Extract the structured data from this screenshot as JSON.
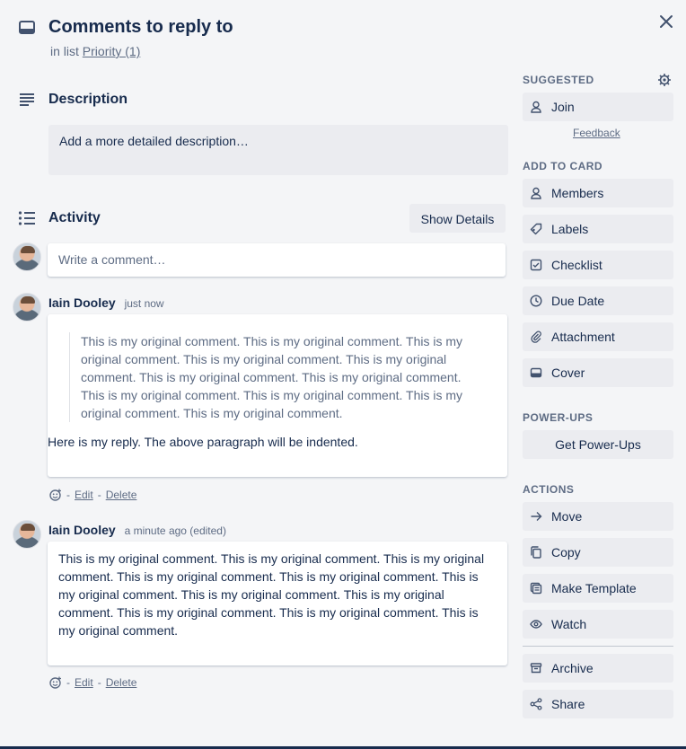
{
  "card": {
    "title": "Comments to reply to",
    "in_list_prefix": "in list",
    "list_name": "Priority (1)"
  },
  "description": {
    "heading": "Description",
    "placeholder": "Add a more detailed description…"
  },
  "activity": {
    "heading": "Activity",
    "show_details": "Show Details",
    "comment_placeholder": "Write a comment…",
    "comments": [
      {
        "author": "Iain Dooley",
        "time": "just now",
        "quote": "This is my original comment. This is my original comment. This is my original comment. This is my original comment. This is my original comment. This is my original comment. This is my original comment. This is my original comment. This is my original comment. This is my original comment. This is my original comment.",
        "body": "Here is my reply. The above paragraph will be indented.",
        "separator": "-",
        "edit": "Edit",
        "delete": "Delete"
      },
      {
        "author": "Iain Dooley",
        "time": "a minute ago (edited)",
        "body": "This is my original comment. This is my original comment. This is my original comment. This is my original comment. This is my original comment. This is my original comment. This is my original comment. This is my original comment. This is my original comment. This is my original comment. This is my original comment.",
        "separator": "-",
        "edit": "Edit",
        "delete": "Delete"
      }
    ]
  },
  "sidebar": {
    "suggested": {
      "heading": "SUGGESTED",
      "join": "Join",
      "feedback": "Feedback"
    },
    "add_to_card": {
      "heading": "ADD TO CARD",
      "items": [
        "Members",
        "Labels",
        "Checklist",
        "Due Date",
        "Attachment",
        "Cover"
      ]
    },
    "power_ups": {
      "heading": "POWER-UPS",
      "get": "Get Power-Ups"
    },
    "actions": {
      "heading": "ACTIONS",
      "items": [
        "Move",
        "Copy",
        "Make Template",
        "Watch"
      ],
      "items2": [
        "Archive",
        "Share"
      ]
    }
  },
  "icons": {
    "card": "card-icon",
    "close": "close-icon",
    "description": "description-lines-icon",
    "activity": "activity-list-icon",
    "emoji": "add-reaction-icon",
    "gear": "gear-icon"
  }
}
